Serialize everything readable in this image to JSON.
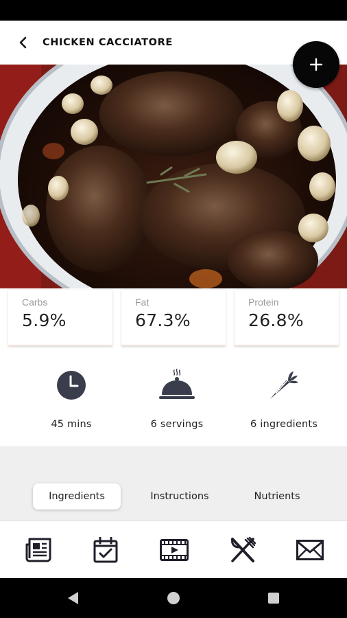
{
  "header": {
    "title": "CHICKEN CACCIATORE",
    "back_icon": "back-arrow-icon"
  },
  "fab": {
    "icon": "plus-icon"
  },
  "hero": {
    "description_icon": "recipe-photo"
  },
  "macros": [
    {
      "label": "Carbs",
      "value": "5.9%"
    },
    {
      "label": "Fat",
      "value": "67.3%"
    },
    {
      "label": "Protein",
      "value": "26.8%"
    }
  ],
  "stats": [
    {
      "icon": "clock-icon",
      "label": "45 mins"
    },
    {
      "icon": "serving-cloche-icon",
      "label": "6 servings"
    },
    {
      "icon": "carrot-icon",
      "label": "6 ingredients"
    }
  ],
  "tabs": [
    {
      "label": "Ingredients",
      "active": true
    },
    {
      "label": "Instructions",
      "active": false
    },
    {
      "label": "Nutrients",
      "active": false
    }
  ],
  "bottom_nav": [
    {
      "icon": "newspaper-icon"
    },
    {
      "icon": "calendar-check-icon"
    },
    {
      "icon": "film-icon"
    },
    {
      "icon": "fork-knife-icon"
    },
    {
      "icon": "envelope-icon"
    }
  ],
  "colors": {
    "accent_dark": "#070707",
    "icon_dark": "#3a3d4b",
    "tab_bg": "#efefef"
  }
}
